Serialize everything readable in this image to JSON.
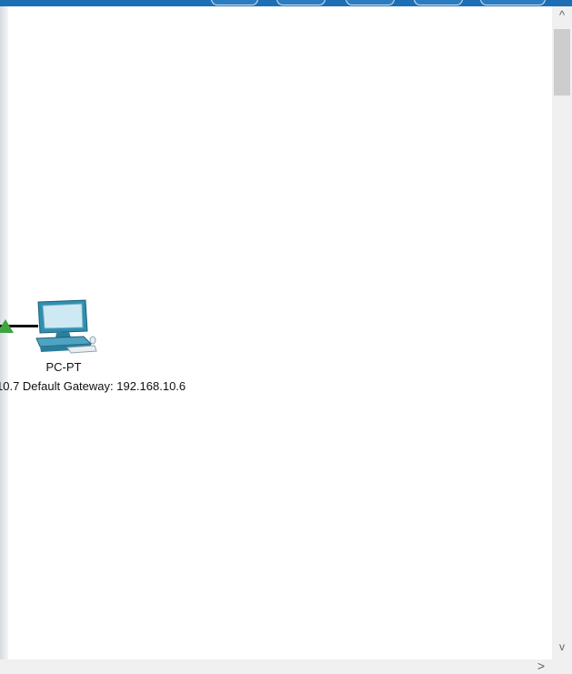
{
  "device": {
    "name": "PC-PT",
    "info": "10.7 Default Gateway: 192.168.10.6",
    "icon": "pc-icon",
    "link_status_color": "#3fa33f"
  },
  "scrollbars": {
    "up_arrow": "^",
    "down_arrow": "v",
    "right_arrow": ">"
  },
  "colors": {
    "toolbar": "#1d6fb5",
    "workspace": "#ffffff",
    "scrollbar_track": "#f0f0f0",
    "scrollbar_thumb": "#cdcdcd"
  }
}
